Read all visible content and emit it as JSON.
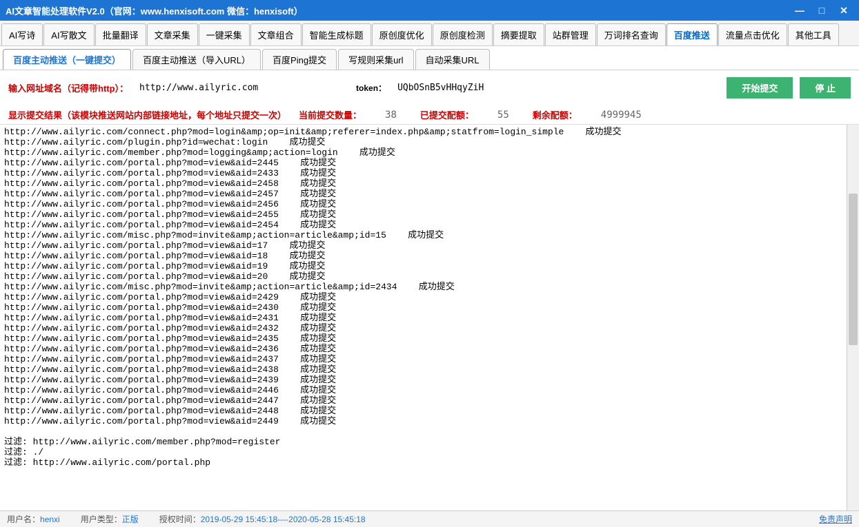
{
  "title": "AI文章智能处理软件V2.0（官网：www.henxisoft.com  微信：henxisoft）",
  "mainTabs": [
    "AI写诗",
    "AI写散文",
    "批量翻译",
    "文章采集",
    "一键采集",
    "文章组合",
    "智能生成标题",
    "原创度优化",
    "原创度检测",
    "摘要提取",
    "站群管理",
    "万词排名查询",
    "百度推送",
    "流量点击优化",
    "其他工具"
  ],
  "mainTabActive": 12,
  "subTabs": [
    "百度主动推送（一键提交）",
    "百度主动推送（导入URL）",
    "百度Ping提交",
    "写规则采集url",
    "自动采集URL"
  ],
  "subTabActive": 0,
  "form": {
    "domainLabel": "输入网址域名（记得带http）：",
    "domainValue": "http://www.ailyric.com",
    "tokenLabel": "token：",
    "tokenValue": "UQbOSnB5vHHqyZiH",
    "startBtn": "开始提交",
    "stopBtn": "停  止"
  },
  "resultHeader": {
    "title": "显示提交结果（该模块推送网站内部链接地址，每个地址只提交一次）",
    "currentLabel": "当前提交数量：",
    "currentValue": "38",
    "submittedLabel": "已提交配额：",
    "submittedValue": "55",
    "remainingLabel": "剩余配额：",
    "remainingValue": "4999945"
  },
  "logLines": [
    "http://www.ailyric.com/connect.php?mod=login&amp;op=init&amp;referer=index.php&amp;statfrom=login_simple    成功提交",
    "http://www.ailyric.com/plugin.php?id=wechat:login    成功提交",
    "http://www.ailyric.com/member.php?mod=logging&amp;action=login    成功提交",
    "http://www.ailyric.com/portal.php?mod=view&aid=2445    成功提交",
    "http://www.ailyric.com/portal.php?mod=view&aid=2433    成功提交",
    "http://www.ailyric.com/portal.php?mod=view&aid=2458    成功提交",
    "http://www.ailyric.com/portal.php?mod=view&aid=2457    成功提交",
    "http://www.ailyric.com/portal.php?mod=view&aid=2456    成功提交",
    "http://www.ailyric.com/portal.php?mod=view&aid=2455    成功提交",
    "http://www.ailyric.com/portal.php?mod=view&aid=2454    成功提交",
    "http://www.ailyric.com/misc.php?mod=invite&amp;action=article&amp;id=15    成功提交",
    "http://www.ailyric.com/portal.php?mod=view&aid=17    成功提交",
    "http://www.ailyric.com/portal.php?mod=view&aid=18    成功提交",
    "http://www.ailyric.com/portal.php?mod=view&aid=19    成功提交",
    "http://www.ailyric.com/portal.php?mod=view&aid=20    成功提交",
    "http://www.ailyric.com/misc.php?mod=invite&amp;action=article&amp;id=2434    成功提交",
    "http://www.ailyric.com/portal.php?mod=view&aid=2429    成功提交",
    "http://www.ailyric.com/portal.php?mod=view&aid=2430    成功提交",
    "http://www.ailyric.com/portal.php?mod=view&aid=2431    成功提交",
    "http://www.ailyric.com/portal.php?mod=view&aid=2432    成功提交",
    "http://www.ailyric.com/portal.php?mod=view&aid=2435    成功提交",
    "http://www.ailyric.com/portal.php?mod=view&aid=2436    成功提交",
    "http://www.ailyric.com/portal.php?mod=view&aid=2437    成功提交",
    "http://www.ailyric.com/portal.php?mod=view&aid=2438    成功提交",
    "http://www.ailyric.com/portal.php?mod=view&aid=2439    成功提交",
    "http://www.ailyric.com/portal.php?mod=view&aid=2446    成功提交",
    "http://www.ailyric.com/portal.php?mod=view&aid=2447    成功提交",
    "http://www.ailyric.com/portal.php?mod=view&aid=2448    成功提交",
    "http://www.ailyric.com/portal.php?mod=view&aid=2449    成功提交",
    "",
    "过滤: http://www.ailyric.com/member.php?mod=register",
    "过滤: ./",
    "过滤: http://www.ailyric.com/portal.php"
  ],
  "status": {
    "userLabel": "用户名：",
    "userValue": "henxi",
    "typeLabel": "用户类型：",
    "typeValue": "正版",
    "authLabel": "授权时间：",
    "authValue": "2019-05-29 15:45:18----2020-05-28 15:45:18",
    "disclaimer": "免责声明"
  }
}
